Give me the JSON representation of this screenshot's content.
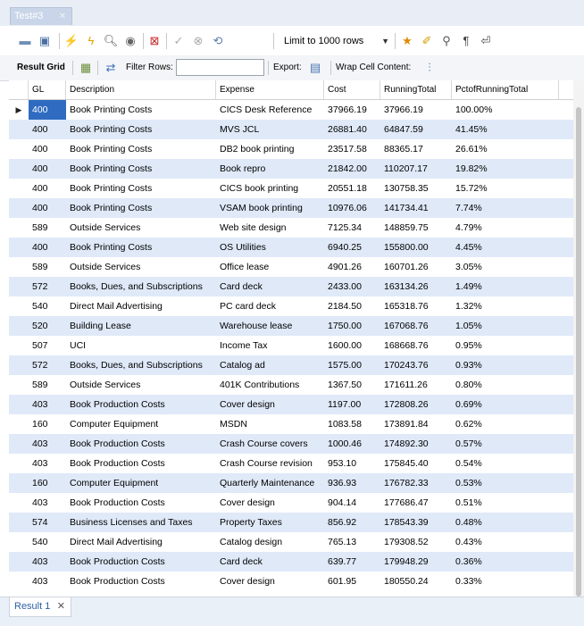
{
  "window": {
    "tab_title": "Test#3"
  },
  "toolbar": {
    "limit_label": "Limit to 1000 rows"
  },
  "result_toolbar": {
    "result_grid_label": "Result Grid",
    "filter_rows_label": "Filter Rows:",
    "filter_value": "",
    "export_label": "Export:",
    "wrap_label": "Wrap Cell Content:"
  },
  "columns": [
    "GL",
    "Description",
    "Expense",
    "Cost",
    "RunningTotal",
    "PctofRunningTotal"
  ],
  "rows": [
    [
      "400",
      "Book Printing Costs",
      "CICS Desk Reference",
      "37966.19",
      "37966.19",
      "100.00%"
    ],
    [
      "400",
      "Book Printing Costs",
      "MVS JCL",
      "26881.40",
      "64847.59",
      "41.45%"
    ],
    [
      "400",
      "Book Printing Costs",
      "DB2 book printing",
      "23517.58",
      "88365.17",
      "26.61%"
    ],
    [
      "400",
      "Book Printing Costs",
      "Book repro",
      "21842.00",
      "110207.17",
      "19.82%"
    ],
    [
      "400",
      "Book Printing Costs",
      "CICS book printing",
      "20551.18",
      "130758.35",
      "15.72%"
    ],
    [
      "400",
      "Book Printing Costs",
      "VSAM book printing",
      "10976.06",
      "141734.41",
      "7.74%"
    ],
    [
      "589",
      "Outside Services",
      "Web site design",
      "7125.34",
      "148859.75",
      "4.79%"
    ],
    [
      "400",
      "Book Printing Costs",
      "OS Utilities",
      "6940.25",
      "155800.00",
      "4.45%"
    ],
    [
      "589",
      "Outside Services",
      "Office lease",
      "4901.26",
      "160701.26",
      "3.05%"
    ],
    [
      "572",
      "Books, Dues, and Subscriptions",
      "Card deck",
      "2433.00",
      "163134.26",
      "1.49%"
    ],
    [
      "540",
      "Direct Mail Advertising",
      "PC card deck",
      "2184.50",
      "165318.76",
      "1.32%"
    ],
    [
      "520",
      "Building Lease",
      "Warehouse lease",
      "1750.00",
      "167068.76",
      "1.05%"
    ],
    [
      "507",
      "UCI",
      "Income Tax",
      "1600.00",
      "168668.76",
      "0.95%"
    ],
    [
      "572",
      "Books, Dues, and Subscriptions",
      "Catalog ad",
      "1575.00",
      "170243.76",
      "0.93%"
    ],
    [
      "589",
      "Outside Services",
      "401K Contributions",
      "1367.50",
      "171611.26",
      "0.80%"
    ],
    [
      "403",
      "Book Production Costs",
      "Cover design",
      "1197.00",
      "172808.26",
      "0.69%"
    ],
    [
      "160",
      "Computer Equipment",
      "MSDN",
      "1083.58",
      "173891.84",
      "0.62%"
    ],
    [
      "403",
      "Book Production Costs",
      "Crash Course covers",
      "1000.46",
      "174892.30",
      "0.57%"
    ],
    [
      "403",
      "Book Production Costs",
      "Crash Course revision",
      "953.10",
      "175845.40",
      "0.54%"
    ],
    [
      "160",
      "Computer Equipment",
      "Quarterly Maintenance",
      "936.93",
      "176782.33",
      "0.53%"
    ],
    [
      "403",
      "Book Production Costs",
      "Cover design",
      "904.14",
      "177686.47",
      "0.51%"
    ],
    [
      "574",
      "Business Licenses and Taxes",
      "Property Taxes",
      "856.92",
      "178543.39",
      "0.48%"
    ],
    [
      "540",
      "Direct Mail Advertising",
      "Catalog design",
      "765.13",
      "179308.52",
      "0.43%"
    ],
    [
      "403",
      "Book Production Costs",
      "Card deck",
      "639.77",
      "179948.29",
      "0.36%"
    ],
    [
      "403",
      "Book Production Costs",
      "Cover design",
      "601.95",
      "180550.24",
      "0.33%"
    ]
  ],
  "bottom": {
    "result_tab_label": "Result 1"
  },
  "icons": {
    "toolbar": [
      "open-folder-icon",
      "save-icon",
      "execute-icon",
      "execute-current-icon",
      "explain-icon",
      "stop-icon",
      "toggle-continue-icon",
      "commit-icon",
      "rollback-icon",
      "autocommit-icon",
      "beautify-icon",
      "bookmark-icon",
      "find-icon",
      "invisible-chars-icon",
      "wrap-icon"
    ]
  }
}
